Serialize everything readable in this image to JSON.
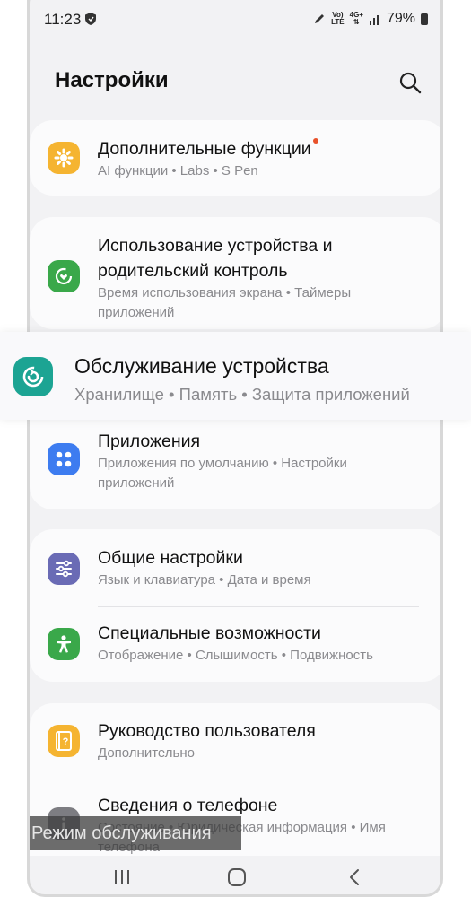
{
  "status_bar": {
    "time": "11:23",
    "network_top": "Vo)",
    "network_bottom": "LTE",
    "net_gen": "4G+",
    "battery": "79%"
  },
  "header": {
    "title": "Настройки",
    "search_icon": "search-icon"
  },
  "items": [
    {
      "title": "Дополнительные функции",
      "subtitle": "AI функции  •  Labs  •  S Pen",
      "icon": "advanced-features-icon",
      "color": "#f5b431",
      "badge": true
    },
    {
      "title": "Использование устройства и родительский контроль",
      "subtitle": "Время использования экрана  •  Таймеры приложений",
      "icon": "digital-wellbeing-icon",
      "color": "#3aa84a"
    },
    {
      "title": "Приложения",
      "subtitle": "Приложения по умолчанию  •  Настройки приложений",
      "icon": "apps-icon",
      "color": "#3d7cf0"
    },
    {
      "title": "Общие настройки",
      "subtitle": "Язык и клавиатура  •  Дата и время",
      "icon": "general-settings-icon",
      "color": "#6a6bb5"
    },
    {
      "title": "Специальные возможности",
      "subtitle": "Отображение  •  Слышимость  •  Подвижность",
      "icon": "accessibility-icon",
      "color": "#3aa84a"
    },
    {
      "title": "Руководство пользователя",
      "subtitle": "Дополнительно",
      "icon": "user-manual-icon",
      "color": "#f5b431"
    },
    {
      "title": "Сведения о телефоне",
      "subtitle": "Состояние  •  Юридическая информация  •  Имя телефона",
      "icon": "about-phone-icon",
      "color": "#7d7d82"
    }
  ],
  "highlighted": {
    "title": "Обслуживание устройства",
    "subtitle": "Хранилище  •  Память  •  Защита приложений",
    "icon": "device-care-icon",
    "color": "#1ca493"
  },
  "overlay": {
    "label": "Режим обслуживания"
  },
  "navbar": {
    "recents": "recents-icon",
    "home": "home-icon",
    "back": "back-icon"
  }
}
